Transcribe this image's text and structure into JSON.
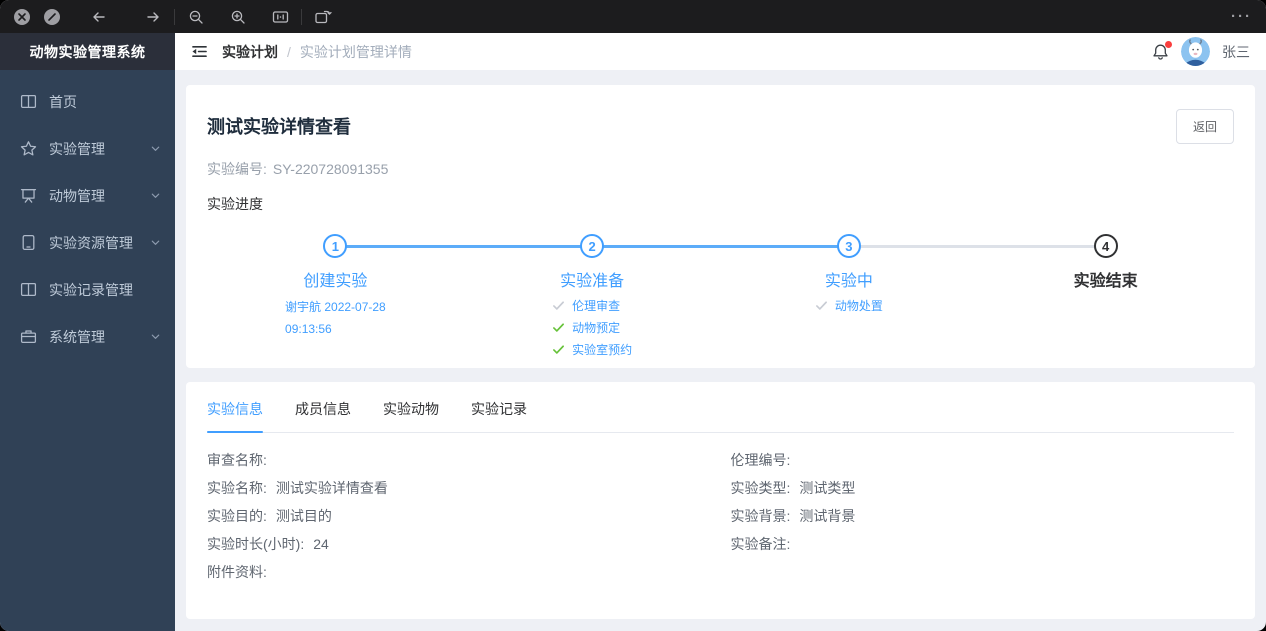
{
  "titlebar": {
    "more_label": "···"
  },
  "sidebar": {
    "title": "动物实验管理系统",
    "items": [
      {
        "label": "首页",
        "icon": "open-book-icon",
        "expandable": false
      },
      {
        "label": "实验管理",
        "icon": "star-icon",
        "expandable": true
      },
      {
        "label": "动物管理",
        "icon": "board-icon",
        "expandable": true
      },
      {
        "label": "实验资源管理",
        "icon": "tablet-icon",
        "expandable": true
      },
      {
        "label": "实验记录管理",
        "icon": "open-book-icon",
        "expandable": false
      },
      {
        "label": "系统管理",
        "icon": "briefcase-icon",
        "expandable": true
      }
    ]
  },
  "header": {
    "breadcrumb": {
      "parent": "实验计划",
      "separator": "/",
      "current": "实验计划管理详情"
    },
    "user_name": "张三"
  },
  "detail": {
    "title": "测试实验详情查看",
    "back_button": "返回",
    "code_label": "实验编号:",
    "code_value": "SY-220728091355",
    "progress_label": "实验进度"
  },
  "steps": [
    {
      "num": "1",
      "title": "创建实验",
      "note_line1": "谢宇航 2022-07-28",
      "note_line2": "09:13:56",
      "state": "done"
    },
    {
      "num": "2",
      "title": "实验准备",
      "state": "done",
      "checks": [
        {
          "label": "伦理审查",
          "state": "pending"
        },
        {
          "label": "动物预定",
          "state": "done"
        },
        {
          "label": "实验室预约",
          "state": "done"
        }
      ]
    },
    {
      "num": "3",
      "title": "实验中",
      "state": "current",
      "checks": [
        {
          "label": "动物处置",
          "state": "pending"
        }
      ]
    },
    {
      "num": "4",
      "title": "实验结束",
      "state": "wait"
    }
  ],
  "tabs": [
    {
      "label": "实验信息",
      "active": true
    },
    {
      "label": "成员信息",
      "active": false
    },
    {
      "label": "实验动物",
      "active": false
    },
    {
      "label": "实验记录",
      "active": false
    }
  ],
  "info": {
    "left": [
      {
        "label": "审查名称:",
        "value": ""
      },
      {
        "label": "实验名称:",
        "value": "测试实验详情查看"
      },
      {
        "label": "实验目的:",
        "value": "测试目的"
      },
      {
        "label": "实验时长(小时):",
        "value": "24"
      },
      {
        "label": "附件资料:",
        "value": ""
      }
    ],
    "right": [
      {
        "label": "伦理编号:",
        "value": ""
      },
      {
        "label": "实验类型:",
        "value": "测试类型"
      },
      {
        "label": "实验背景:",
        "value": "测试背景"
      },
      {
        "label": "实验备注:",
        "value": ""
      }
    ]
  },
  "colors": {
    "accent": "#409eff",
    "success": "#67c23a",
    "pending_check": "#c0c4cc",
    "sidebar_bg": "#304156",
    "logo_bg": "#2b2f3a",
    "notification_badge": "#fa3e3e",
    "step_wait": "#303133"
  }
}
